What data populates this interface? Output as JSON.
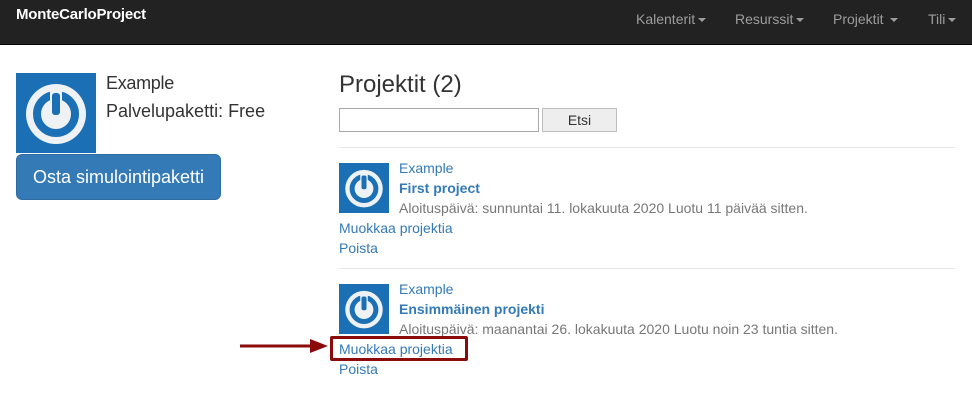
{
  "navbar": {
    "brand": "MonteCarloProject",
    "items": [
      {
        "label": "Kalenterit"
      },
      {
        "label": "Resurssit"
      },
      {
        "label": "Projektit"
      },
      {
        "label": "Tili"
      }
    ]
  },
  "profile": {
    "name": "Example",
    "package": "Palvelupaketti: Free",
    "buy_label": "Osta simulointipaketti",
    "logo_icon": "power-icon"
  },
  "projects": {
    "title": "Projektit (2)",
    "search": {
      "value": "",
      "button_label": "Etsi"
    },
    "items": [
      {
        "owner": "Example",
        "name": "First project",
        "meta": "Aloituspäivä: sunnuntai 11. lokakuuta 2020 Luotu 11 päivää sitten.",
        "edit_label": "Muokkaa projektia",
        "delete_label": "Poista"
      },
      {
        "owner": "Example",
        "name": "Ensimmäinen projekti",
        "meta": "Aloituspäivä: maanantai 26. lokakuuta 2020 Luotu noin 23 tuntia sitten.",
        "edit_label": "Muokkaa projektia",
        "delete_label": "Poista"
      }
    ]
  },
  "colors": {
    "navbar_bg": "#222222",
    "link": "#337ab7",
    "logo_bg": "#1a6fb5",
    "annotation": "#8b0a0a"
  }
}
